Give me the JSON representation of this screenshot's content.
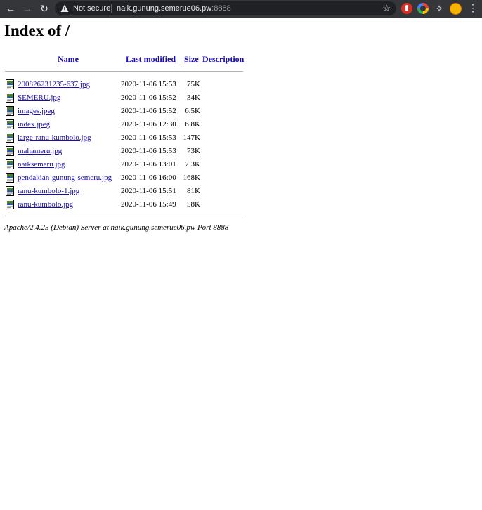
{
  "browser": {
    "security_label": "Not secure",
    "url_host": "naik.gunung.semerue06.pw",
    "url_port": ":8888",
    "back_icon": "arrow-left-icon",
    "forward_icon": "arrow-right-icon",
    "reload_icon": "reload-icon",
    "star_icon": "star-icon",
    "extensions_icon": "puzzle-icon"
  },
  "page": {
    "title": "Index of /",
    "columns": {
      "name": "Name",
      "last_modified": "Last modified",
      "size": "Size",
      "description": "Description"
    },
    "files": [
      {
        "name": "200826231235-637.jpg",
        "modified": "2020-11-06 15:53",
        "size": "75K"
      },
      {
        "name": "SEMERU.jpg",
        "modified": "2020-11-06 15:52",
        "size": "34K"
      },
      {
        "name": "images.jpeg",
        "modified": "2020-11-06 15:52",
        "size": "6.5K"
      },
      {
        "name": "index.jpeg",
        "modified": "2020-11-06 12:30",
        "size": "6.8K"
      },
      {
        "name": "large-ranu-kumbolo.jpg",
        "modified": "2020-11-06 15:53",
        "size": "147K"
      },
      {
        "name": "mahameru.jpg",
        "modified": "2020-11-06 15:53",
        "size": "73K"
      },
      {
        "name": "naiksemeru.jpg",
        "modified": "2020-11-06 13:01",
        "size": "7.3K"
      },
      {
        "name": "pendakian-gunung-semeru.jpg",
        "modified": "2020-11-06 16:00",
        "size": "168K"
      },
      {
        "name": "ranu-kumbolo-1.jpg",
        "modified": "2020-11-06 15:51",
        "size": "81K"
      },
      {
        "name": "ranu-kumbolo.jpg",
        "modified": "2020-11-06 15:49",
        "size": "58K"
      }
    ],
    "footer": "Apache/2.4.25 (Debian) Server at naik.gunung.semerue06.pw Port 8888"
  },
  "colors": {
    "chrome_bg": "#35363a",
    "omnibox_bg": "#202124",
    "link": "#1a0dab"
  }
}
